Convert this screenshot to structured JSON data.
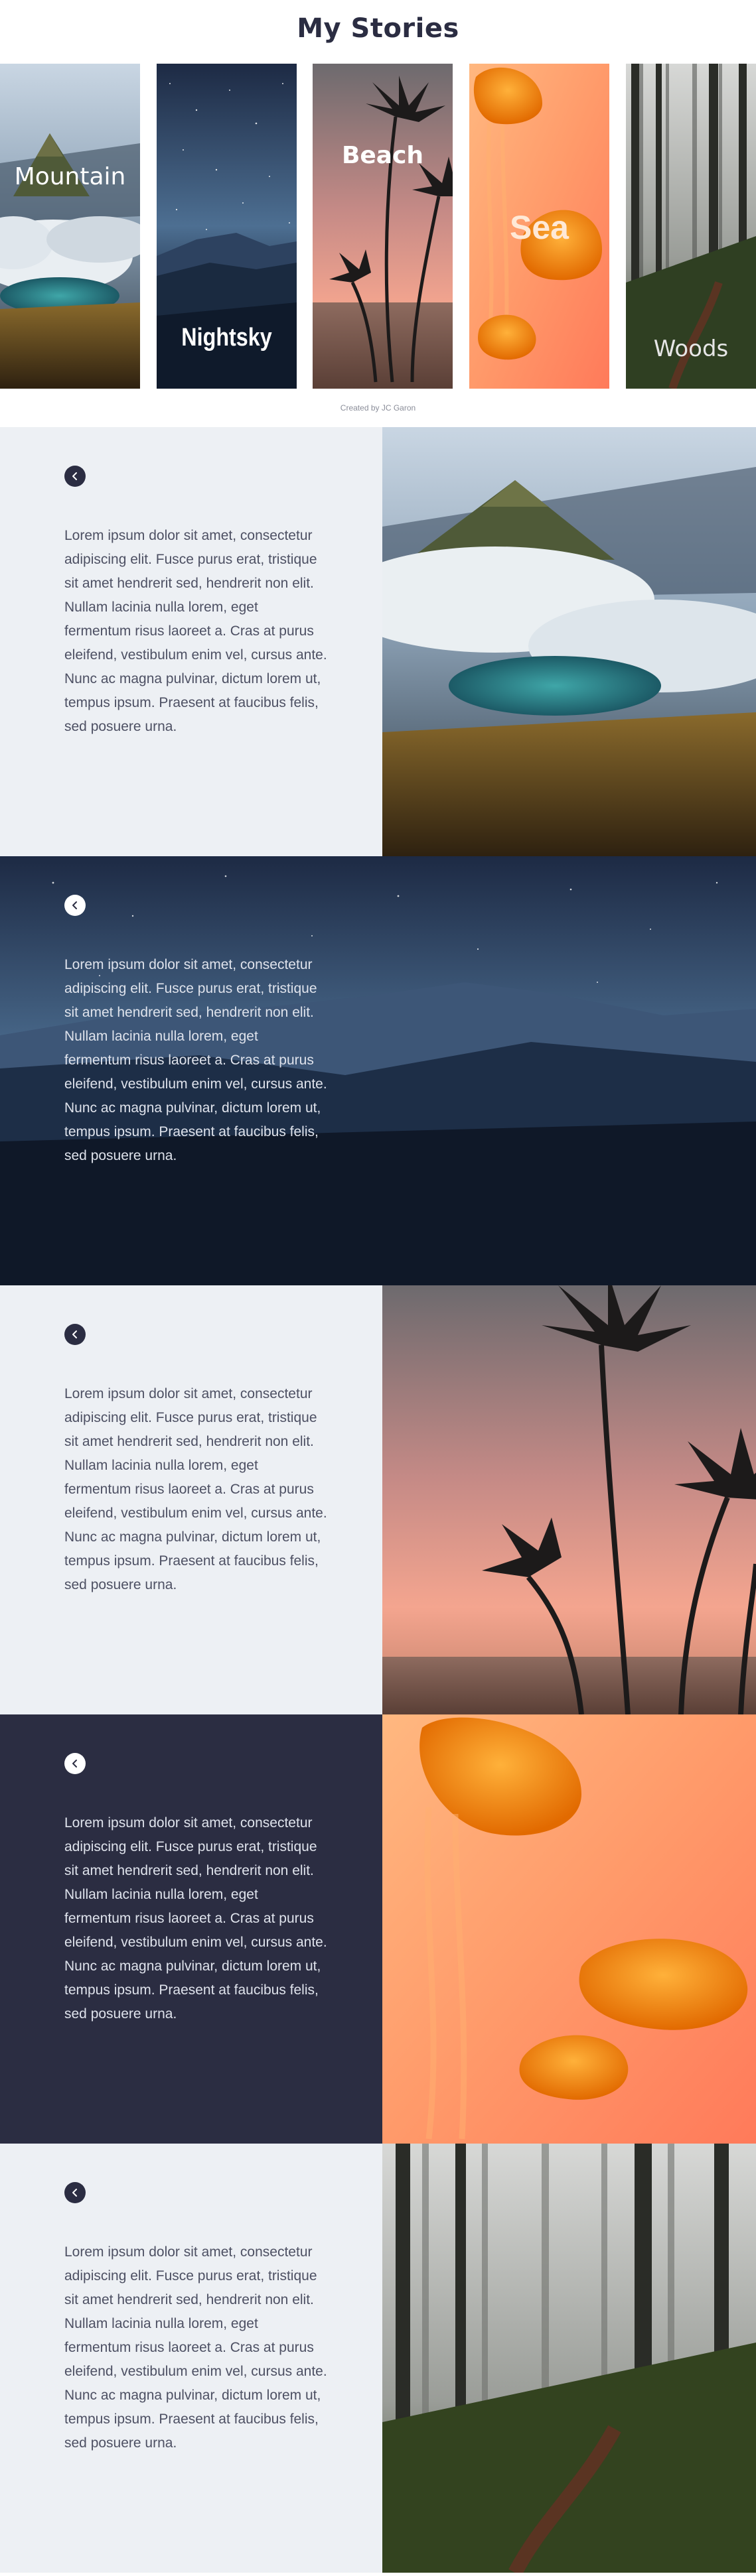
{
  "page": {
    "title": "My Stories",
    "credit": "Created by JC Garon"
  },
  "cards": [
    {
      "id": "mountain",
      "label": "Mountain"
    },
    {
      "id": "nightsky",
      "label": "Nightsky"
    },
    {
      "id": "beach",
      "label": "Beach"
    },
    {
      "id": "sea",
      "label": "Sea"
    },
    {
      "id": "woods",
      "label": "Woods"
    }
  ],
  "story_text": "Lorem ipsum dolor sit amet, consectetur adipiscing elit. Fusce purus erat, tristique sit amet hendrerit sed, hendrerit non elit. Nullam lacinia nulla lorem, eget fermentum risus laoreet a. Cras at purus eleifend, vestibulum enim vel, cursus ante. Nunc ac magna pulvinar, dictum lorem ut, tempus ipsum. Praesent at faucibus felis, sed posuere urna.",
  "panels": [
    {
      "id": "mountain",
      "text_bg": "#edf0f4"
    },
    {
      "id": "nightsky",
      "text_bg": "#2e3e58"
    },
    {
      "id": "beach",
      "text_bg": "#edf0f4"
    },
    {
      "id": "sea",
      "text_bg": "#2b2d42"
    },
    {
      "id": "woods",
      "text_bg": "#edf0f4"
    }
  ],
  "colors": {
    "heading": "#2b2d42",
    "panel_light": "#edf0f4",
    "panel_dark": "#2b2d42"
  },
  "icons": {
    "back": "chevron-left-icon"
  }
}
